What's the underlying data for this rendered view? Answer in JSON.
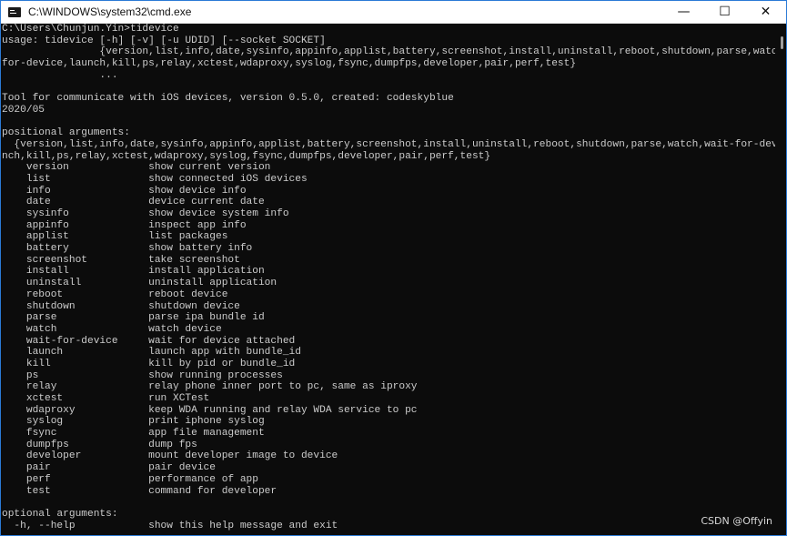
{
  "window": {
    "title": "C:\\WINDOWS\\system32\\cmd.exe",
    "app_icon": "console-icon",
    "controls": {
      "minimize": "—",
      "maximize": "☐",
      "close": "✕"
    }
  },
  "console": {
    "lines": [
      "C:\\Users\\Chunjun.Yin>tidevice",
      "usage: tidevice [-h] [-v] [-u UDID] [--socket SOCKET]",
      "                {version,list,info,date,sysinfo,appinfo,applist,battery,screenshot,install,uninstall,reboot,shutdown,parse,watch,wait-",
      "for-device,launch,kill,ps,relay,xctest,wdaproxy,syslog,fsync,dumpfps,developer,pair,perf,test}",
      "                ...",
      "",
      "Tool for communicate with iOS devices, version 0.5.0, created: codeskyblue",
      "2020/05",
      "",
      "positional arguments:",
      "  {version,list,info,date,sysinfo,appinfo,applist,battery,screenshot,install,uninstall,reboot,shutdown,parse,watch,wait-for-device,lau",
      "nch,kill,ps,relay,xctest,wdaproxy,syslog,fsync,dumpfps,developer,pair,perf,test}",
      "    version             show current version",
      "    list                show connected iOS devices",
      "    info                show device info",
      "    date                device current date",
      "    sysinfo             show device system info",
      "    appinfo             inspect app info",
      "    applist             list packages",
      "    battery             show battery info",
      "    screenshot          take screenshot",
      "    install             install application",
      "    uninstall           uninstall application",
      "    reboot              reboot device",
      "    shutdown            shutdown device",
      "    parse               parse ipa bundle id",
      "    watch               watch device",
      "    wait-for-device     wait for device attached",
      "    launch              launch app with bundle_id",
      "    kill                kill by pid or bundle_id",
      "    ps                  show running processes",
      "    relay               relay phone inner port to pc, same as iproxy",
      "    xctest              run XCTest",
      "    wdaproxy            keep WDA running and relay WDA service to pc",
      "    syslog              print iphone syslog",
      "    fsync               app file management",
      "    dumpfps             dump fps",
      "    developer           mount developer image to device",
      "    pair                pair device",
      "    perf                performance of app",
      "    test                command for developer",
      "",
      "optional arguments:",
      "  -h, --help            show this help message and exit"
    ]
  },
  "watermark": "CSDN @Offyin",
  "colors": {
    "console_bg": "#0c0c0c",
    "console_text": "#cccccc",
    "titlebar_bg": "#ffffff",
    "window_border": "#2b7ad6"
  }
}
